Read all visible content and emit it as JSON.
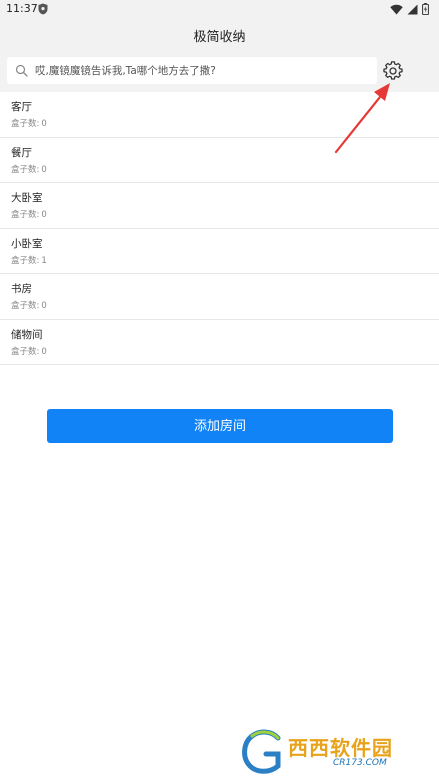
{
  "status_bar": {
    "time": "11:37"
  },
  "header": {
    "title": "极简收纳"
  },
  "search": {
    "placeholder": "哎,魔镜魔镜告诉我,Ta哪个地方去了撒?"
  },
  "rooms": [
    {
      "name": "客厅",
      "count_label": "盒子数:",
      "count": "0"
    },
    {
      "name": "餐厅",
      "count_label": "盒子数:",
      "count": "0"
    },
    {
      "name": "大卧室",
      "count_label": "盒子数:",
      "count": "0"
    },
    {
      "name": "小卧室",
      "count_label": "盒子数:",
      "count": "1"
    },
    {
      "name": "书房",
      "count_label": "盒子数:",
      "count": "0"
    },
    {
      "name": "储物间",
      "count_label": "盒子数:",
      "count": "0"
    }
  ],
  "actions": {
    "add_room_label": "添加房间"
  },
  "watermark": {
    "text": "西西软件园",
    "sub": "CR173.COM"
  },
  "colors": {
    "accent": "#1183f6",
    "annotation": "#e53935",
    "bar_bg": "#f2f2f2"
  },
  "icons": {
    "search": "search-icon",
    "settings": "gear-icon",
    "wifi": "wifi-icon",
    "battery": "battery-icon"
  }
}
